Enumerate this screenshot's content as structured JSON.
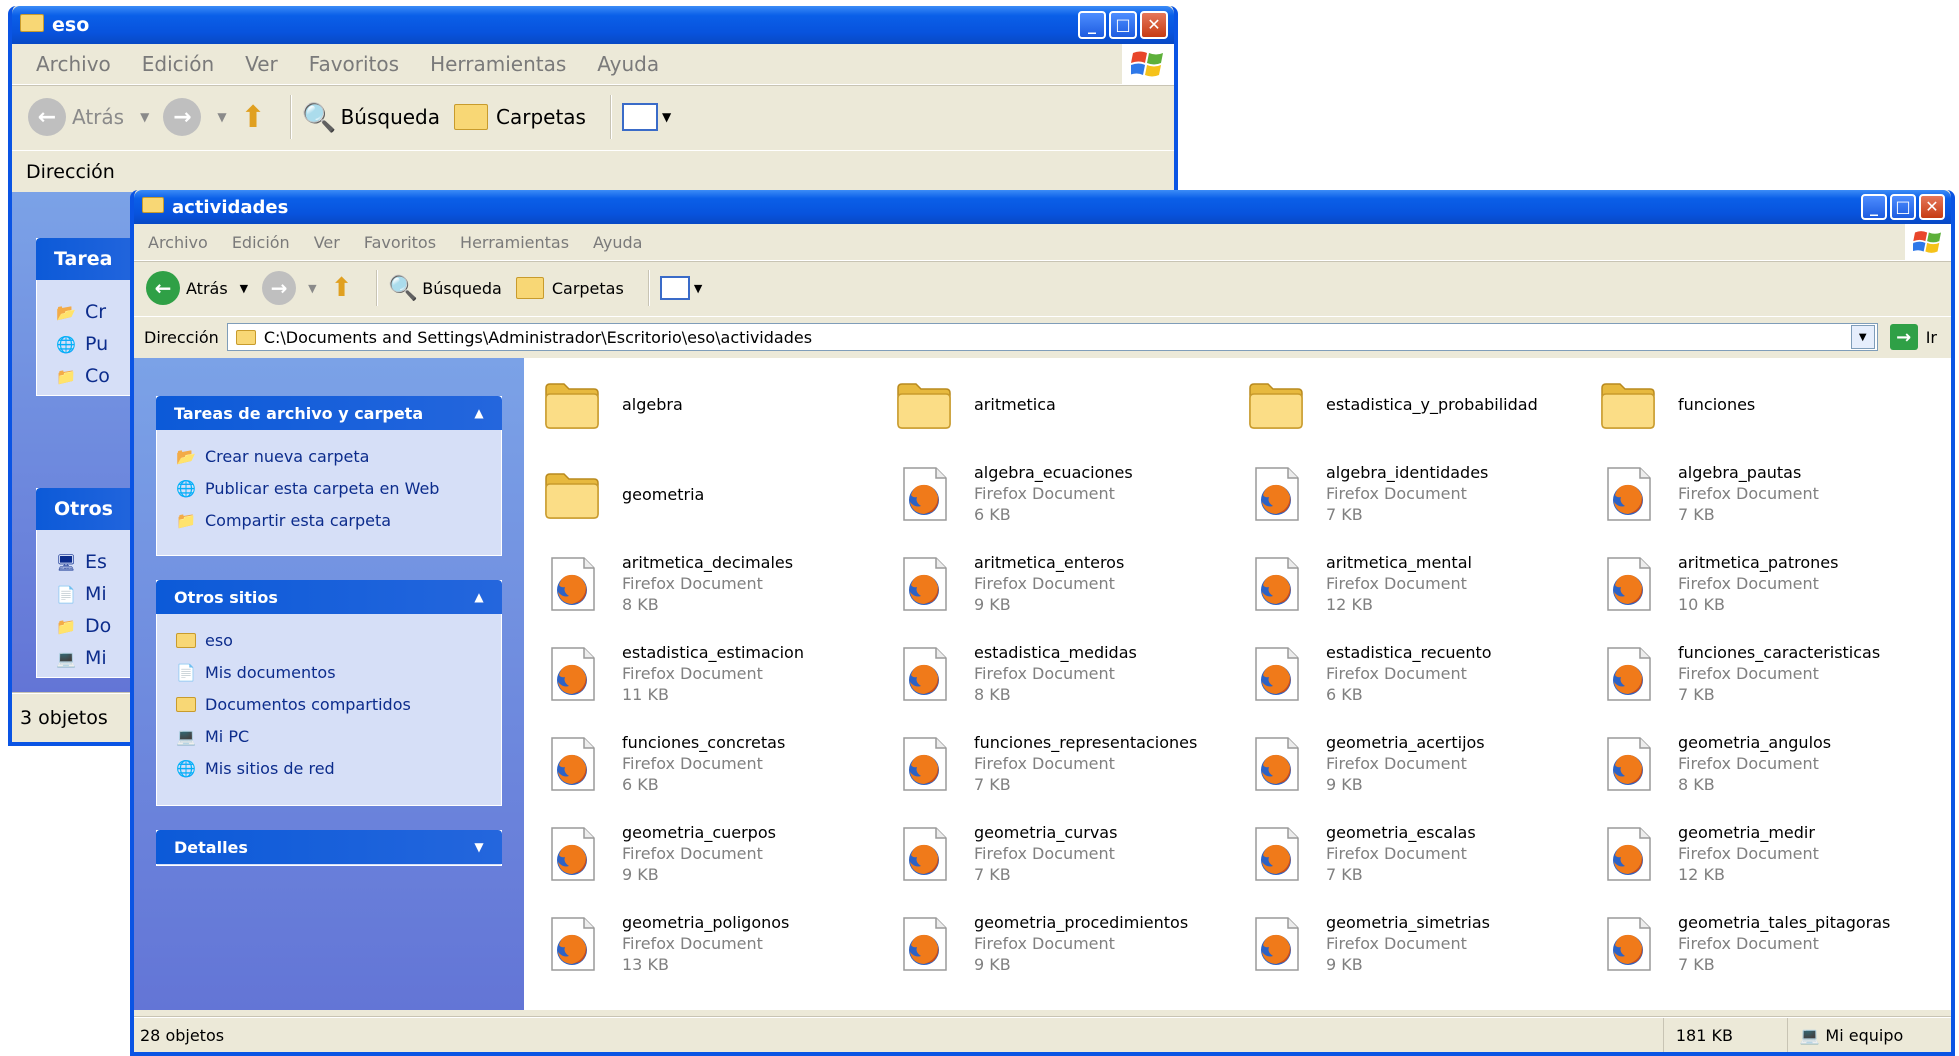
{
  "back_window": {
    "title": "eso",
    "menu": [
      "Archivo",
      "Edición",
      "Ver",
      "Favoritos",
      "Herramientas",
      "Ayuda"
    ],
    "toolbar": {
      "back": "Atrás",
      "search": "Búsqueda",
      "folders": "Carpetas"
    },
    "address_label": "Dirección",
    "panel1_title": "Tarea",
    "panel1_items": [
      "Cr",
      "Pu",
      "Co"
    ],
    "panel2_title": "Otros",
    "panel2_items": [
      "Es",
      "Mi",
      "Do",
      "Mi"
    ],
    "status": "3 objetos"
  },
  "front_window": {
    "title": "actividades",
    "menu": [
      "Archivo",
      "Edición",
      "Ver",
      "Favoritos",
      "Herramientas",
      "Ayuda"
    ],
    "toolbar": {
      "back": "Atrás",
      "search": "Búsqueda",
      "folders": "Carpetas"
    },
    "address_label": "Dirección",
    "address_value": "C:\\Documents and Settings\\Administrador\\Escritorio\\eso\\actividades",
    "go_label": "Ir",
    "tasks_panel": {
      "title": "Tareas de archivo y carpeta",
      "items": [
        "Crear nueva carpeta",
        "Publicar esta carpeta en Web",
        "Compartir esta carpeta"
      ]
    },
    "places_panel": {
      "title": "Otros sitios",
      "items": [
        "eso",
        "Mis documentos",
        "Documentos compartidos",
        "Mi PC",
        "Mis sitios de red"
      ]
    },
    "details_panel": {
      "title": "Detalles"
    },
    "files": [
      {
        "name": "algebra",
        "kind": "folder"
      },
      {
        "name": "aritmetica",
        "kind": "folder"
      },
      {
        "name": "estadistica_y_probabilidad",
        "kind": "folder"
      },
      {
        "name": "funciones",
        "kind": "folder"
      },
      {
        "name": "geometria",
        "kind": "folder"
      },
      {
        "name": "algebra_ecuaciones",
        "kind": "doc",
        "type": "Firefox Document",
        "size": "6 KB"
      },
      {
        "name": "algebra_identidades",
        "kind": "doc",
        "type": "Firefox Document",
        "size": "7 KB"
      },
      {
        "name": "algebra_pautas",
        "kind": "doc",
        "type": "Firefox Document",
        "size": "7 KB"
      },
      {
        "name": "aritmetica_decimales",
        "kind": "doc",
        "type": "Firefox Document",
        "size": "8 KB"
      },
      {
        "name": "aritmetica_enteros",
        "kind": "doc",
        "type": "Firefox Document",
        "size": "9 KB"
      },
      {
        "name": "aritmetica_mental",
        "kind": "doc",
        "type": "Firefox Document",
        "size": "12 KB"
      },
      {
        "name": "aritmetica_patrones",
        "kind": "doc",
        "type": "Firefox Document",
        "size": "10 KB"
      },
      {
        "name": "estadistica_estimacion",
        "kind": "doc",
        "type": "Firefox Document",
        "size": "11 KB"
      },
      {
        "name": "estadistica_medidas",
        "kind": "doc",
        "type": "Firefox Document",
        "size": "8 KB"
      },
      {
        "name": "estadistica_recuento",
        "kind": "doc",
        "type": "Firefox Document",
        "size": "6 KB"
      },
      {
        "name": "funciones_caracteristicas",
        "kind": "doc",
        "type": "Firefox Document",
        "size": "7 KB"
      },
      {
        "name": "funciones_concretas",
        "kind": "doc",
        "type": "Firefox Document",
        "size": "6 KB"
      },
      {
        "name": "funciones_representaciones",
        "kind": "doc",
        "type": "Firefox Document",
        "size": "7 KB"
      },
      {
        "name": "geometria_acertijos",
        "kind": "doc",
        "type": "Firefox Document",
        "size": "9 KB"
      },
      {
        "name": "geometria_angulos",
        "kind": "doc",
        "type": "Firefox Document",
        "size": "8 KB"
      },
      {
        "name": "geometria_cuerpos",
        "kind": "doc",
        "type": "Firefox Document",
        "size": "9 KB"
      },
      {
        "name": "geometria_curvas",
        "kind": "doc",
        "type": "Firefox Document",
        "size": "7 KB"
      },
      {
        "name": "geometria_escalas",
        "kind": "doc",
        "type": "Firefox Document",
        "size": "7 KB"
      },
      {
        "name": "geometria_medir",
        "kind": "doc",
        "type": "Firefox Document",
        "size": "12 KB"
      },
      {
        "name": "geometria_poligonos",
        "kind": "doc",
        "type": "Firefox Document",
        "size": "13 KB"
      },
      {
        "name": "geometria_procedimientos",
        "kind": "doc",
        "type": "Firefox Document",
        "size": "9 KB"
      },
      {
        "name": "geometria_simetrias",
        "kind": "doc",
        "type": "Firefox Document",
        "size": "9 KB"
      },
      {
        "name": "geometria_tales_pitagoras",
        "kind": "doc",
        "type": "Firefox Document",
        "size": "7 KB"
      }
    ],
    "status": {
      "count": "28 objetos",
      "size": "181 KB",
      "zone": "Mi equipo"
    }
  }
}
